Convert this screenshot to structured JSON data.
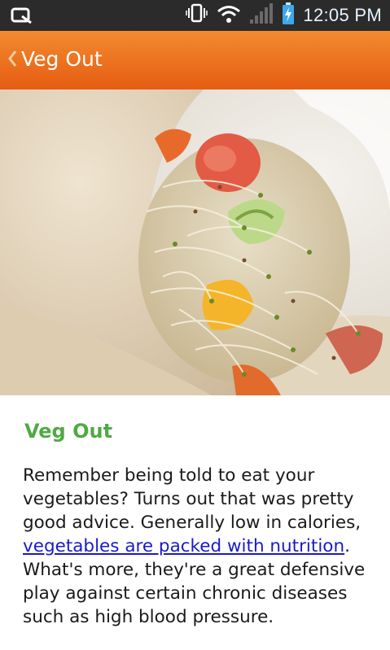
{
  "status_bar": {
    "time": "12:05 PM",
    "icons": [
      "app-notification-icon",
      "vibrate-icon",
      "wifi-icon",
      "signal-icon",
      "battery-charging-icon"
    ]
  },
  "app_bar": {
    "back_icon": "chevron-left-icon",
    "title": "Veg Out"
  },
  "article": {
    "hero_image": "veggie-wrap-photo",
    "title": "Veg Out",
    "paragraph_start": "Remember being told to eat your vegetables? Turns out that was pretty good advice. Generally low in calories, ",
    "link_text": "vegetables are packed with nutrition",
    "paragraph_end": ". What's more, they're a great defensive play against certain chronic diseases such as high blood pressure."
  },
  "colors": {
    "status_bar_bg": "#2b2b2b",
    "app_bar_orange": "#ee7a22",
    "title_green": "#4faa43",
    "link_blue": "#1a1acc"
  }
}
